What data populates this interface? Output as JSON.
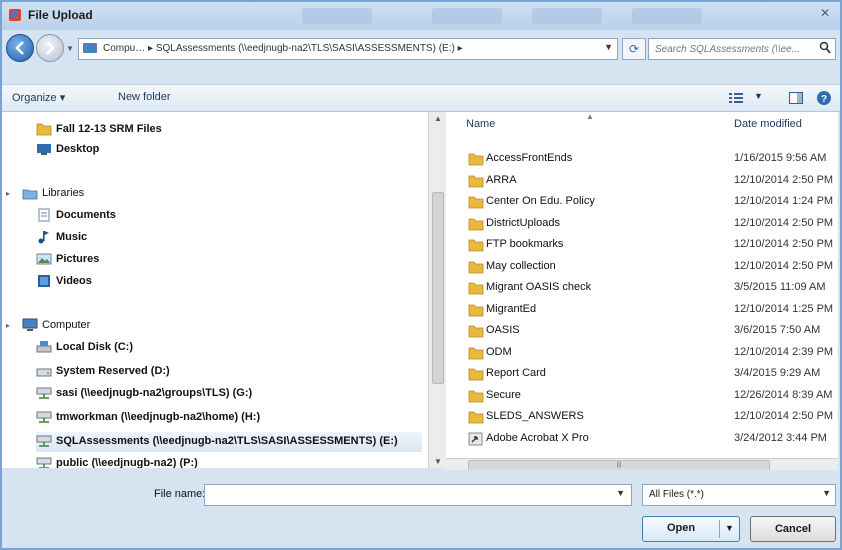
{
  "window": {
    "title": "File Upload",
    "close_glyph": "✕"
  },
  "navigation": {
    "address_crumbs": "Compu…  ▸  SQLAssessments (\\\\eedjnugb-na2\\TLS\\SASI\\ASSESSMENTS) (E:)  ▸",
    "search_placeholder": "Search SQLAssessments (\\\\ee...",
    "refresh_glyph": "⟳"
  },
  "toolbar": {
    "organize_label": "Organize ▾",
    "new_folder_label": "New folder"
  },
  "nav_pane": {
    "items": [
      {
        "label": "Fall 12-13 SRM Files",
        "icon": "folder-icon",
        "bold": true
      },
      {
        "label": "Desktop",
        "icon": "desktop-icon",
        "bold": true
      },
      {
        "label": "Libraries",
        "icon": "libraries-icon",
        "bold": false
      },
      {
        "label": "Documents",
        "icon": "documents-icon",
        "bold": true
      },
      {
        "label": "Music",
        "icon": "music-icon",
        "bold": true
      },
      {
        "label": "Pictures",
        "icon": "pictures-icon",
        "bold": true
      },
      {
        "label": "Videos",
        "icon": "videos-icon",
        "bold": true
      },
      {
        "label": "Computer",
        "icon": "computer-icon",
        "bold": false
      },
      {
        "label": "Local Disk (C:)",
        "icon": "local-disk-icon",
        "bold": true
      },
      {
        "label": "System Reserved (D:)",
        "icon": "drive-icon",
        "bold": true
      },
      {
        "label": "sasi (\\\\eedjnugb-na2\\groups\\TLS) (G:)",
        "icon": "network-drive-icon",
        "bold": true
      },
      {
        "label": "tmworkman (\\\\eedjnugb-na2\\home) (H:)",
        "icon": "network-drive-icon",
        "bold": true
      },
      {
        "label": "SQLAssessments (\\\\eedjnugb-na2\\TLS\\SASI\\ASSESSMENTS) (E:)",
        "icon": "network-drive-icon",
        "bold": true
      },
      {
        "label": "public (\\\\eedjnugb-na2) (P:)",
        "icon": "network-drive-icon",
        "bold": true
      }
    ]
  },
  "file_list": {
    "col_name": "Name",
    "col_date": "Date modified",
    "rows": [
      {
        "name": "AccessFrontEnds",
        "date": "1/16/2015 9:56 AM",
        "icon": "folder-icon"
      },
      {
        "name": "ARRA",
        "date": "12/10/2014 2:50 PM",
        "icon": "folder-icon"
      },
      {
        "name": "Center On Edu. Policy",
        "date": "12/10/2014 1:24 PM",
        "icon": "folder-icon"
      },
      {
        "name": "DistrictUploads",
        "date": "12/10/2014 2:50 PM",
        "icon": "folder-icon"
      },
      {
        "name": "FTP bookmarks",
        "date": "12/10/2014 2:50 PM",
        "icon": "folder-icon"
      },
      {
        "name": "May collection",
        "date": "12/10/2014 2:50 PM",
        "icon": "folder-icon"
      },
      {
        "name": "Migrant OASIS check",
        "date": "3/5/2015 11:09 AM",
        "icon": "folder-icon"
      },
      {
        "name": "MigrantEd",
        "date": "12/10/2014 1:25 PM",
        "icon": "folder-icon"
      },
      {
        "name": "OASIS",
        "date": "3/6/2015 7:50 AM",
        "icon": "folder-icon"
      },
      {
        "name": "ODM",
        "date": "12/10/2014 2:39 PM",
        "icon": "folder-icon"
      },
      {
        "name": "Report Card",
        "date": "3/4/2015 9:29 AM",
        "icon": "folder-icon"
      },
      {
        "name": "Secure",
        "date": "12/26/2014 8:39 AM",
        "icon": "folder-icon"
      },
      {
        "name": "SLEDS_ANSWERS",
        "date": "12/10/2014 2:50 PM",
        "icon": "folder-icon"
      },
      {
        "name": "Adobe Acrobat X Pro",
        "date": "3/24/2012 3:44 PM",
        "icon": "shortcut-icon"
      }
    ]
  },
  "bottom": {
    "file_name_label": "File name:",
    "file_name_value": "",
    "filter_value": "All Files (*.*)",
    "open_label": "Open",
    "cancel_label": "Cancel"
  },
  "colors": {
    "folder": "#e8b93c",
    "accent_blue": "#2f6db3"
  }
}
